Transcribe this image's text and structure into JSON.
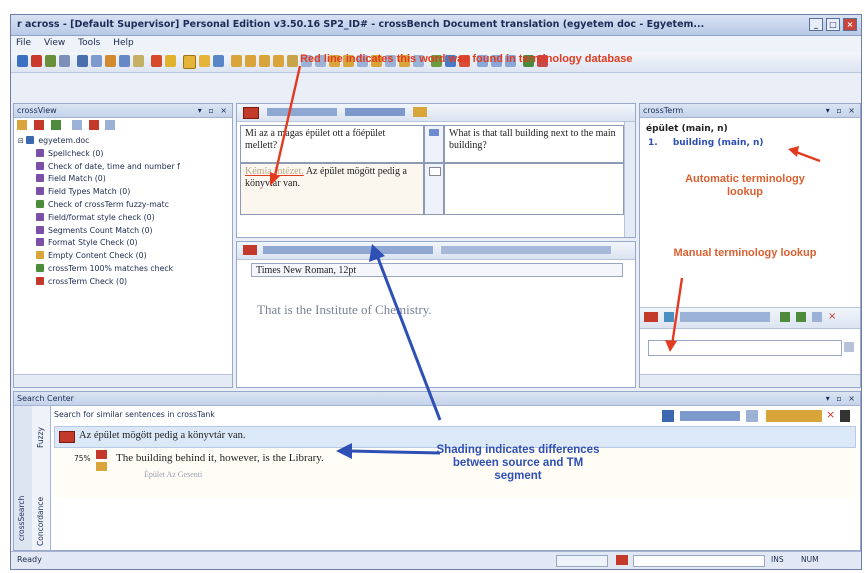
{
  "window": {
    "title": "r across - [Default Supervisor] Personal Edition v3.50.16 SP2_ID# - crossBench Document translation (egyetem doc - Egyetem..."
  },
  "menu": [
    "File",
    "View",
    "Tools",
    "Help"
  ],
  "left_panel": {
    "title": "crossView",
    "root": "egyetem.doc",
    "items": [
      "Spellcheck (0)",
      "Check of date, time and number f",
      "Field Match (0)",
      "Field Types Match (0)",
      "Check of crossTerm fuzzy-matc",
      "Field/format style check (0)",
      "Segments Count Match (0)",
      "Format Style Check (0)",
      "Empty Content Check (0)",
      "crossTerm 100% matches check",
      "crossTerm Check (0)"
    ]
  },
  "segments": {
    "rows": [
      {
        "source": "Mi az a magas épület ott a főépület mellett?",
        "target": "What is that tall building next to the main building?"
      },
      {
        "source": "Az épület mögött pedig a könyvtár van.",
        "source_strike": "Kémia Intézet.",
        "source_rest": "Az épület mögött pedig a könyvtár van.",
        "target": ""
      }
    ]
  },
  "editor": {
    "font": "Times New Roman, 12pt",
    "text": "That is the Institute of Chemistry."
  },
  "crossterm": {
    "title": "crossTerm",
    "entry": "épület (main, n)",
    "result_num": "1.",
    "result": "building (main, n)"
  },
  "search_center": {
    "title": "Search Center",
    "subtitle": "Search for similar sentences in crossTank",
    "source": "Az épület mögött pedig a könyvtár van.",
    "match_pct": "75%",
    "match_target": "The building behind it, however, is the Library.",
    "match_note": "Épület Az Gesenti",
    "tabs": [
      "Fuzzy",
      "Concordance"
    ],
    "side": "crossSearch"
  },
  "status": {
    "ready": "Ready",
    "mode": "INS",
    "num": "NUM"
  },
  "annotations": {
    "red_top": "Red line indicates this word was found in terminology database",
    "auto_lookup": "Automatic terminology lookup",
    "manual_lookup": "Manual terminology lookup",
    "shading": "Shading indicates differences between source and TM segment"
  },
  "colors": {
    "annotation_red": "#e23b20",
    "annotation_blue": "#2e4fb4"
  }
}
